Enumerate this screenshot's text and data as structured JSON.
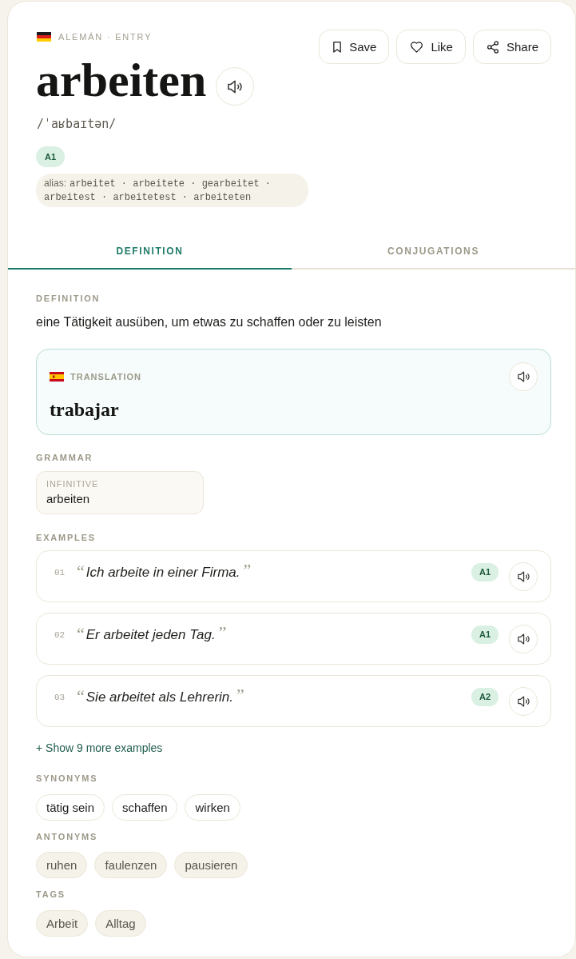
{
  "header": {
    "meta": "ALEMÁN · ENTRY",
    "word": "arbeiten",
    "ipa": "/ˈaʁbaɪtən/",
    "cefr": "A1",
    "alias": {
      "label": "alias:",
      "forms": "arbeitet · arbeitete · gearbeitet · arbeitest · arbeitetest · arbeiteten"
    }
  },
  "actions": [
    {
      "kind": "save",
      "label": "Save"
    },
    {
      "kind": "like",
      "label": "Like"
    },
    {
      "kind": "share",
      "label": "Share"
    }
  ],
  "tabs": [
    {
      "label": "DEFINITION",
      "selected": true
    },
    {
      "label": "CONJUGATIONS",
      "selected": false
    }
  ],
  "definition": {
    "heading": "DEFINITION",
    "text": "eine Tätigkeit ausüben, um etwas zu schaffen oder zu leisten"
  },
  "translation": {
    "label": "TRANSLATION",
    "text": "trabajar"
  },
  "grammar": {
    "heading": "GRAMMAR",
    "fields": [
      {
        "label": "INFINITIVE",
        "value": "arbeiten"
      }
    ]
  },
  "examples": {
    "heading": "EXAMPLES",
    "items": [
      {
        "number": "01",
        "open_quote": "“",
        "text": "Ich arbeite in einer Firma.",
        "close_quote": "”",
        "cefr": "A1"
      },
      {
        "number": "02",
        "open_quote": "“",
        "text": "Er arbeitet jeden Tag.",
        "close_quote": "”",
        "cefr": "A1"
      },
      {
        "number": "03",
        "open_quote": "“",
        "text": "Sie arbeitet als Lehrerin.",
        "close_quote": "”",
        "cefr": "A2"
      }
    ],
    "more": "+ Show 9 more examples"
  },
  "synonyms": {
    "heading": "SYNONYMS",
    "items": [
      "tätig sein",
      "schaffen",
      "wirken"
    ]
  },
  "antonyms": {
    "heading": "ANTONYMS",
    "items": [
      "ruhen",
      "faulenzen",
      "pausieren"
    ]
  },
  "tags": {
    "heading": "TAGS",
    "items": [
      "Arbeit",
      "Alltag"
    ]
  }
}
